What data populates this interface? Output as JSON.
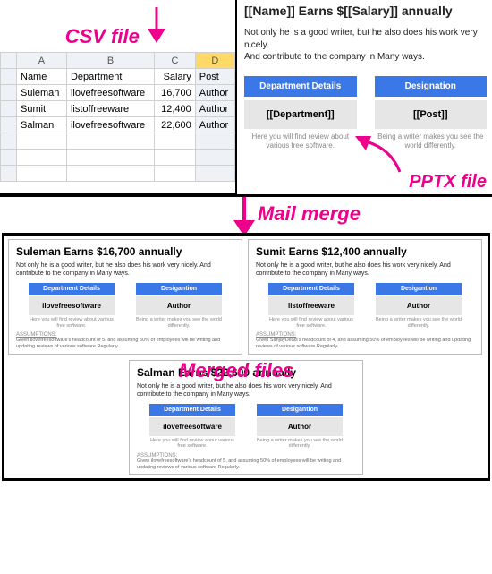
{
  "labels": {
    "csv": "CSV file",
    "pptx": "PPTX file",
    "mailmerge": "Mail merge",
    "merged": "Merged files"
  },
  "sheet": {
    "colA": "A",
    "colB": "B",
    "colC": "C",
    "colD": "D",
    "h_name": "Name",
    "h_dept": "Department",
    "h_sal": "Salary",
    "h_post": "Post",
    "rows": [
      {
        "name": "Suleman",
        "dept": "ilovefreesoftware",
        "sal": "16,700",
        "post": "Author"
      },
      {
        "name": "Sumit",
        "dept": "listoffreeware",
        "sal": "12,400",
        "post": "Author"
      },
      {
        "name": "Salman",
        "dept": "ilovefreesoftware",
        "sal": "22,600",
        "post": "Author"
      }
    ]
  },
  "pptx": {
    "title": "[[Name]] Earns $[[Salary]] annually",
    "body1": "Not only he is a good writer, but he also does his work very nicely.",
    "body2": "And contribute to the company in Many ways.",
    "col1hdr": "Department Details",
    "col1val": "[[Department]]",
    "col1note": "Here you will find review  about various free software.",
    "col2hdr": "Designation",
    "col2val": "[[Post]]",
    "col2note": "Being a writer makes you see the world differently."
  },
  "slideCommon": {
    "bodyFull": "Not only he is a good writer, but he also does his work very nicely. And contribute to the company in Many ways.",
    "col1hdr": "Department Details",
    "col2hdr": "Desigantion",
    "col1note": "Here you will find review  about various free software.",
    "col2note": "Being a writer makes you see the world differently.",
    "assumpHd": "ASSUMPTIONS:"
  },
  "slides": [
    {
      "title": "Suleman Earns $16,700 annually",
      "dept": "ilovefreesoftware",
      "post": "Author",
      "assump": "Given ilovefreesoftware's headcount of 5, and assuming 50% of employees will be writing and updating reviews of various software Regularly."
    },
    {
      "title": "Sumit Earns $12,400 annually",
      "dept": "listoffreeware",
      "post": "Author",
      "assump": "Given SanjayDeals's headcount of 4, and assuming 50% of employees will be writing and updating reviews of various software Regularly."
    },
    {
      "title": "Salman Earns $22,600 annually",
      "dept": "ilovefreesoftware",
      "post": "Author",
      "assump": "Given ilovefreesoftware's headcount of 5, and assuming 50% of employees will be writing and updating reviews of various software Regularly."
    }
  ],
  "chart_data": {
    "type": "table",
    "title": "CSV file",
    "columns": [
      "Name",
      "Department",
      "Salary",
      "Post"
    ],
    "rows": [
      [
        "Suleman",
        "ilovefreesoftware",
        16700,
        "Author"
      ],
      [
        "Sumit",
        "listoffreeware",
        12400,
        "Author"
      ],
      [
        "Salman",
        "ilovefreesoftware",
        22600,
        "Author"
      ]
    ]
  },
  "colors": {
    "accent": "#ec008c",
    "brand": "#3b78e7"
  }
}
